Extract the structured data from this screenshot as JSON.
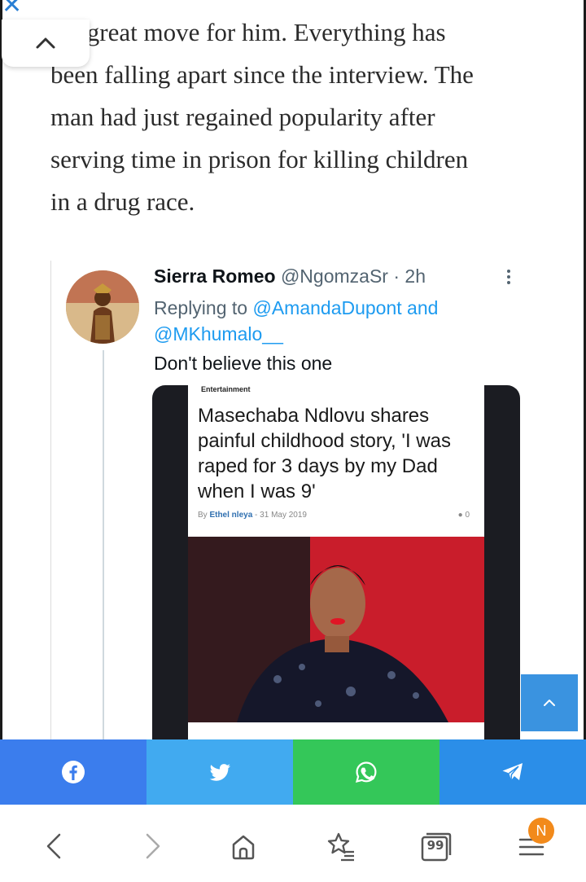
{
  "topbar": {
    "close_icon": "close-icon",
    "accent": "#2a7fd4"
  },
  "article": {
    "paragraph_lines": [
      "n a great move for him. Everything has",
      "been falling apart since the interview. The",
      "man had just regained popularity after",
      "serving time in prison for killing children",
      "in a drug race."
    ]
  },
  "tweet": {
    "display_name": "Sierra Romeo",
    "handle": "@NgomzaSr",
    "separator": "·",
    "time": "2h",
    "replying_to_label": "Replying to",
    "mention_1": "@AmandaDupont",
    "and_label": "and",
    "mention_2": "@MKhumalo__",
    "text": "Don't believe this one",
    "media": {
      "category": "Entertainment",
      "headline": "Masechaba Ndlovu shares painful childhood story, 'I was raped for 3 days by my Dad when I was 9'",
      "byline_prefix": "By",
      "author": "Ethel nleya",
      "date_sep": "-",
      "date": "31 May 2019",
      "comment_count": "0"
    }
  },
  "share_bar": {
    "facebook_color": "#3b7ded",
    "twitter_color": "#41aaf0",
    "whatsapp_color": "#34c759",
    "telegram_color": "#2b8ee8"
  },
  "nav": {
    "tabs_count": "99",
    "notification_badge": "N",
    "badge_color": "#f28a1b"
  }
}
